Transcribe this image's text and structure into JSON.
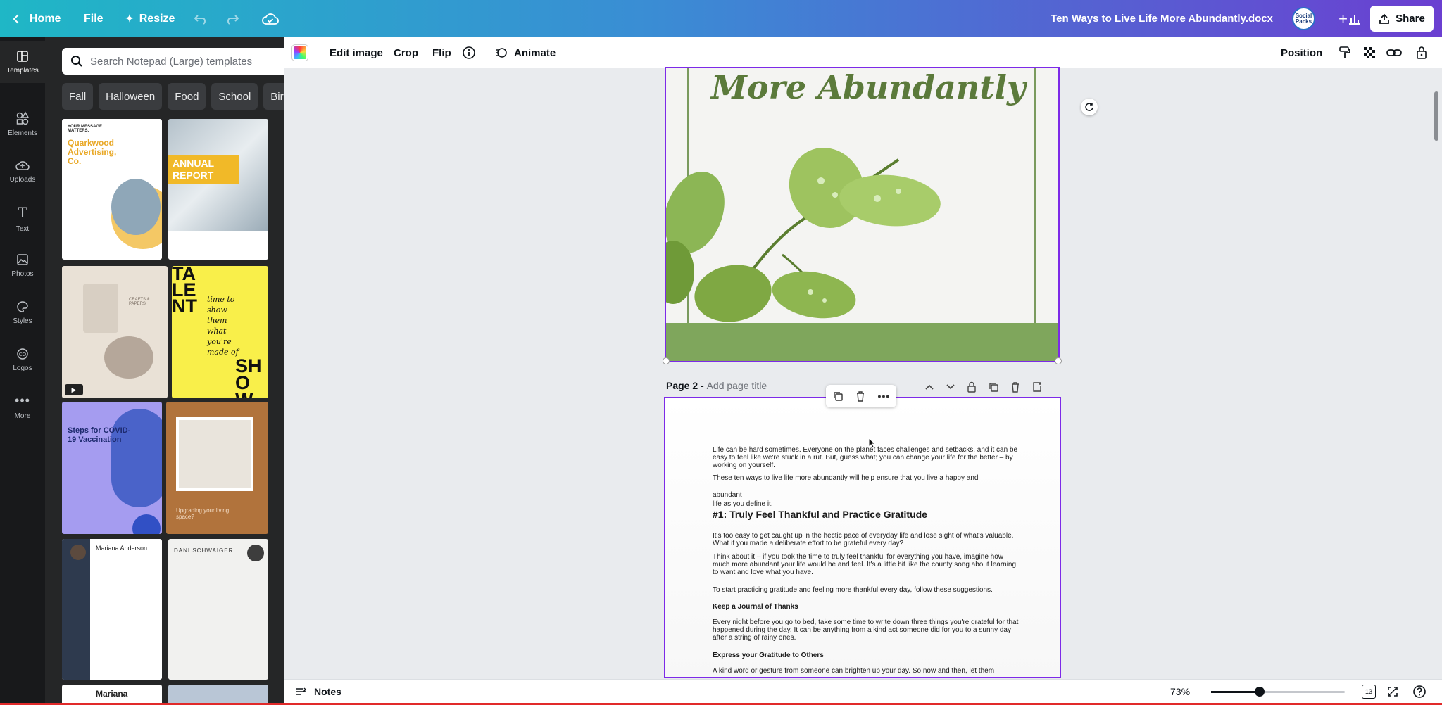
{
  "topbar": {
    "home_label": "Home",
    "file_label": "File",
    "resize_label": "Resize",
    "doc_title": "Ten Ways to Live Life More Abundantly.docx",
    "avatar_text": "Social Packs",
    "share_label": "Share"
  },
  "rail": {
    "items": [
      {
        "label": "Templates"
      },
      {
        "label": "Elements"
      },
      {
        "label": "Uploads"
      },
      {
        "label": "Text"
      },
      {
        "label": "Photos"
      },
      {
        "label": "Styles"
      },
      {
        "label": "Logos"
      },
      {
        "label": "More"
      }
    ]
  },
  "panel": {
    "search_placeholder": "Search Notepad (Large) templates",
    "chips": [
      "Fall",
      "Halloween",
      "Food",
      "School",
      "Birthday"
    ],
    "templates": {
      "t1_line1": "YOUR MESSAGE MATTERS.",
      "t1_title": "Quarkwood Advertising, Co.",
      "t2_title": "ANNUAL REPORT",
      "t3_label": "CRAFTS & PAPERS",
      "t4_big": "TALENT",
      "t4_script": "time to show them what you're made of",
      "t4_show": "SHOW",
      "t5_label": "Steps for COVID-19 Vaccination",
      "t6_label": "Upgrading your living space?",
      "t7_name": "Mariana Anderson",
      "t8_name": "DANI SCHWAIGER",
      "t9_name": "Mariana"
    }
  },
  "toolbar": {
    "edit_image": "Edit image",
    "crop": "Crop",
    "flip": "Flip",
    "animate": "Animate",
    "position": "Position"
  },
  "canvas": {
    "page1_title": "More Abundantly",
    "page2_label": "Page 2 - ",
    "page2_sub": "Add page title",
    "page2_text": {
      "p1": "Life can be hard sometimes. Everyone on the planet faces challenges and setbacks, and it can be easy to feel like we're stuck in a rut. But, guess what; you can change your life for the better – by working on yourself.",
      "p2": "These ten ways to live life more abundantly will help ensure that you live a happy and",
      "p3": "abundant",
      "p4": "life as you define it.",
      "h1": "#1: Truly Feel Thankful and Practice Gratitude",
      "p5": "It's too easy to get caught up in the hectic pace of everyday life and lose sight of what's valuable. What if you made a deliberate effort to be grateful every day?",
      "p6": "Think about it – if you took the time to truly feel thankful for everything you have, imagine how much more abundant your life would be and feel. It's a little bit like the county song about learning to want and love what you have.",
      "p7": "To start practicing gratitude and feeling more thankful every day, follow these suggestions.",
      "h2": "Keep a Journal of Thanks",
      "p8": "Every night before you go to bed, take some time to write down three things you're grateful for that happened during the day. It can be anything from a kind act someone did for you to a sunny day after a string of rainy ones.",
      "h3": "Express your Gratitude to Others",
      "p9": "A kind word or gesture from someone can brighten up your day. So now and then, let them"
    }
  },
  "bottombar": {
    "notes_label": "Notes",
    "zoom_text": "73%",
    "zoom_level": 0.73,
    "page_count": "13"
  },
  "colors": {
    "accent_purple": "#7d2ae8",
    "brand_green": "#7fa65c",
    "title_green": "#5b7a3b"
  }
}
